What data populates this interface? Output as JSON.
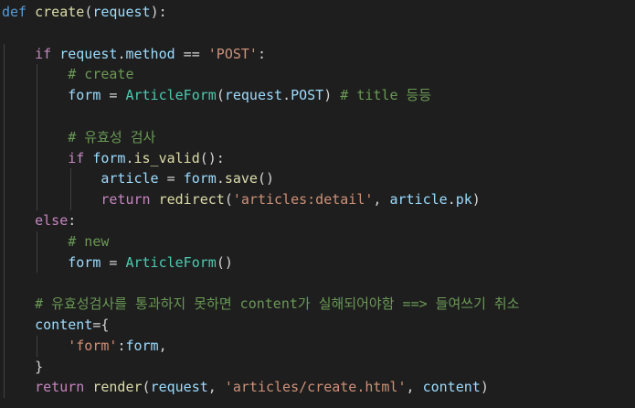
{
  "editor": {
    "colors": {
      "background": "#1e1e1e",
      "indent_guide": "#404040",
      "keyword": "#569cd6",
      "control": "#c586c0",
      "function": "#dcdcaa",
      "class": "#4ec9b0",
      "variable": "#9cdcfe",
      "string": "#ce9178",
      "comment": "#6a9955",
      "plain": "#d4d4d4"
    },
    "lines": [
      [
        {
          "t": "keyword",
          "v": "def"
        },
        {
          "t": "plain",
          "v": " "
        },
        {
          "t": "function",
          "v": "create"
        },
        {
          "t": "plain",
          "v": "("
        },
        {
          "t": "variable",
          "v": "request"
        },
        {
          "t": "plain",
          "v": "):"
        }
      ],
      [],
      [
        {
          "t": "plain",
          "v": "    "
        },
        {
          "t": "control",
          "v": "if"
        },
        {
          "t": "plain",
          "v": " "
        },
        {
          "t": "variable",
          "v": "request"
        },
        {
          "t": "plain",
          "v": "."
        },
        {
          "t": "variable",
          "v": "method"
        },
        {
          "t": "plain",
          "v": " == "
        },
        {
          "t": "string",
          "v": "'POST'"
        },
        {
          "t": "plain",
          "v": ":"
        }
      ],
      [
        {
          "t": "plain",
          "v": "        "
        },
        {
          "t": "comment",
          "v": "# create"
        }
      ],
      [
        {
          "t": "plain",
          "v": "        "
        },
        {
          "t": "variable",
          "v": "form"
        },
        {
          "t": "plain",
          "v": " = "
        },
        {
          "t": "class",
          "v": "ArticleForm"
        },
        {
          "t": "plain",
          "v": "("
        },
        {
          "t": "variable",
          "v": "request"
        },
        {
          "t": "plain",
          "v": "."
        },
        {
          "t": "variable",
          "v": "POST"
        },
        {
          "t": "plain",
          "v": ") "
        },
        {
          "t": "comment",
          "v": "# title 등등"
        }
      ],
      [],
      [
        {
          "t": "plain",
          "v": "        "
        },
        {
          "t": "comment",
          "v": "# 유효성 검사"
        }
      ],
      [
        {
          "t": "plain",
          "v": "        "
        },
        {
          "t": "control",
          "v": "if"
        },
        {
          "t": "plain",
          "v": " "
        },
        {
          "t": "variable",
          "v": "form"
        },
        {
          "t": "plain",
          "v": "."
        },
        {
          "t": "function",
          "v": "is_valid"
        },
        {
          "t": "plain",
          "v": "():"
        }
      ],
      [
        {
          "t": "plain",
          "v": "            "
        },
        {
          "t": "variable",
          "v": "article"
        },
        {
          "t": "plain",
          "v": " = "
        },
        {
          "t": "variable",
          "v": "form"
        },
        {
          "t": "plain",
          "v": "."
        },
        {
          "t": "function",
          "v": "save"
        },
        {
          "t": "plain",
          "v": "()"
        }
      ],
      [
        {
          "t": "plain",
          "v": "            "
        },
        {
          "t": "control",
          "v": "return"
        },
        {
          "t": "plain",
          "v": " "
        },
        {
          "t": "function",
          "v": "redirect"
        },
        {
          "t": "plain",
          "v": "("
        },
        {
          "t": "string",
          "v": "'articles:detail'"
        },
        {
          "t": "plain",
          "v": ", "
        },
        {
          "t": "variable",
          "v": "article"
        },
        {
          "t": "plain",
          "v": "."
        },
        {
          "t": "variable",
          "v": "pk"
        },
        {
          "t": "plain",
          "v": ")"
        }
      ],
      [
        {
          "t": "plain",
          "v": "    "
        },
        {
          "t": "control",
          "v": "else"
        },
        {
          "t": "plain",
          "v": ":"
        }
      ],
      [
        {
          "t": "plain",
          "v": "        "
        },
        {
          "t": "comment",
          "v": "# new"
        }
      ],
      [
        {
          "t": "plain",
          "v": "        "
        },
        {
          "t": "variable",
          "v": "form"
        },
        {
          "t": "plain",
          "v": " = "
        },
        {
          "t": "class",
          "v": "ArticleForm"
        },
        {
          "t": "plain",
          "v": "()"
        }
      ],
      [],
      [
        {
          "t": "plain",
          "v": "    "
        },
        {
          "t": "comment",
          "v": "# 유효성검사를 통과하지 못하면 content가 실해되어야함 ==> 들여쓰기 취소"
        }
      ],
      [
        {
          "t": "plain",
          "v": "    "
        },
        {
          "t": "variable",
          "v": "content"
        },
        {
          "t": "plain",
          "v": "={"
        }
      ],
      [
        {
          "t": "plain",
          "v": "        "
        },
        {
          "t": "string",
          "v": "'form'"
        },
        {
          "t": "plain",
          "v": ":"
        },
        {
          "t": "variable",
          "v": "form"
        },
        {
          "t": "plain",
          "v": ","
        }
      ],
      [
        {
          "t": "plain",
          "v": "    "
        },
        {
          "t": "plain",
          "v": "}"
        }
      ],
      [
        {
          "t": "plain",
          "v": "    "
        },
        {
          "t": "control",
          "v": "return"
        },
        {
          "t": "plain",
          "v": " "
        },
        {
          "t": "function",
          "v": "render"
        },
        {
          "t": "plain",
          "v": "("
        },
        {
          "t": "variable",
          "v": "request"
        },
        {
          "t": "plain",
          "v": ", "
        },
        {
          "t": "string",
          "v": "'articles/create.html'"
        },
        {
          "t": "plain",
          "v": ", "
        },
        {
          "t": "variable",
          "v": "content"
        },
        {
          "t": "plain",
          "v": ")"
        }
      ]
    ]
  }
}
